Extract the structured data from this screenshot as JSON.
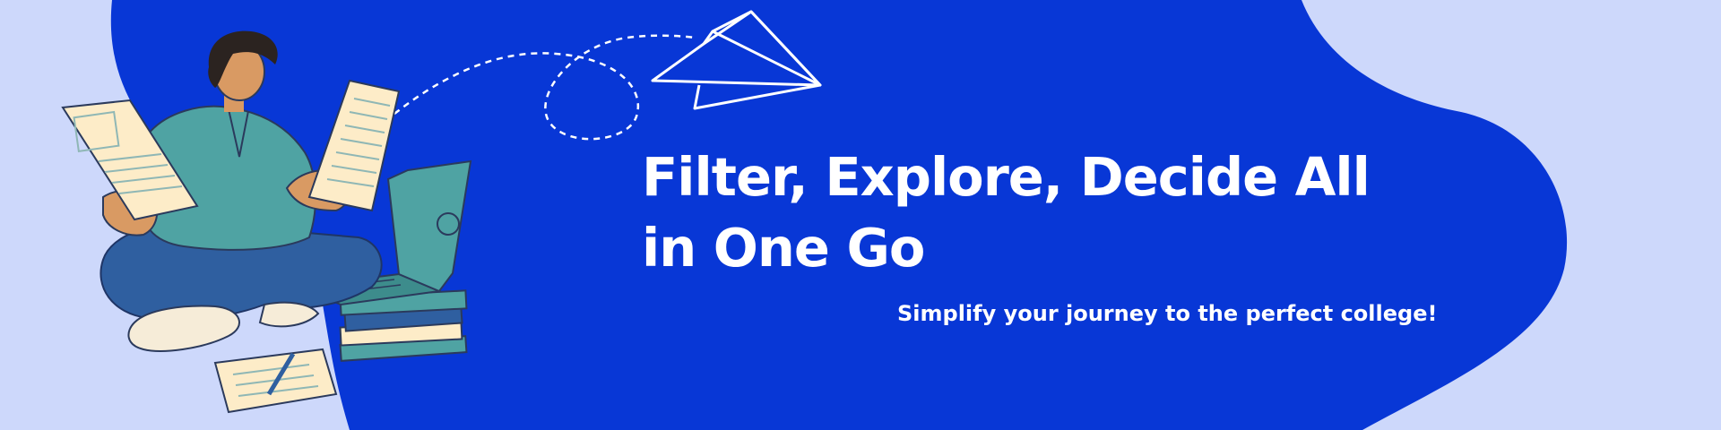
{
  "banner": {
    "headline_line1": "Filter, Explore, Decide All",
    "headline_line2": "in One Go",
    "tagline": "Simplify your journey to the perfect college!"
  },
  "colors": {
    "background": "#cdd8fb",
    "blob": "#0837d6",
    "text": "#ffffff",
    "shirt": "#4fa3a3",
    "pants": "#2f5fa0",
    "paper": "#fdecc8"
  },
  "icons": [
    "paper-plane-icon",
    "student-illustration",
    "laptop-icon",
    "books-icon"
  ]
}
